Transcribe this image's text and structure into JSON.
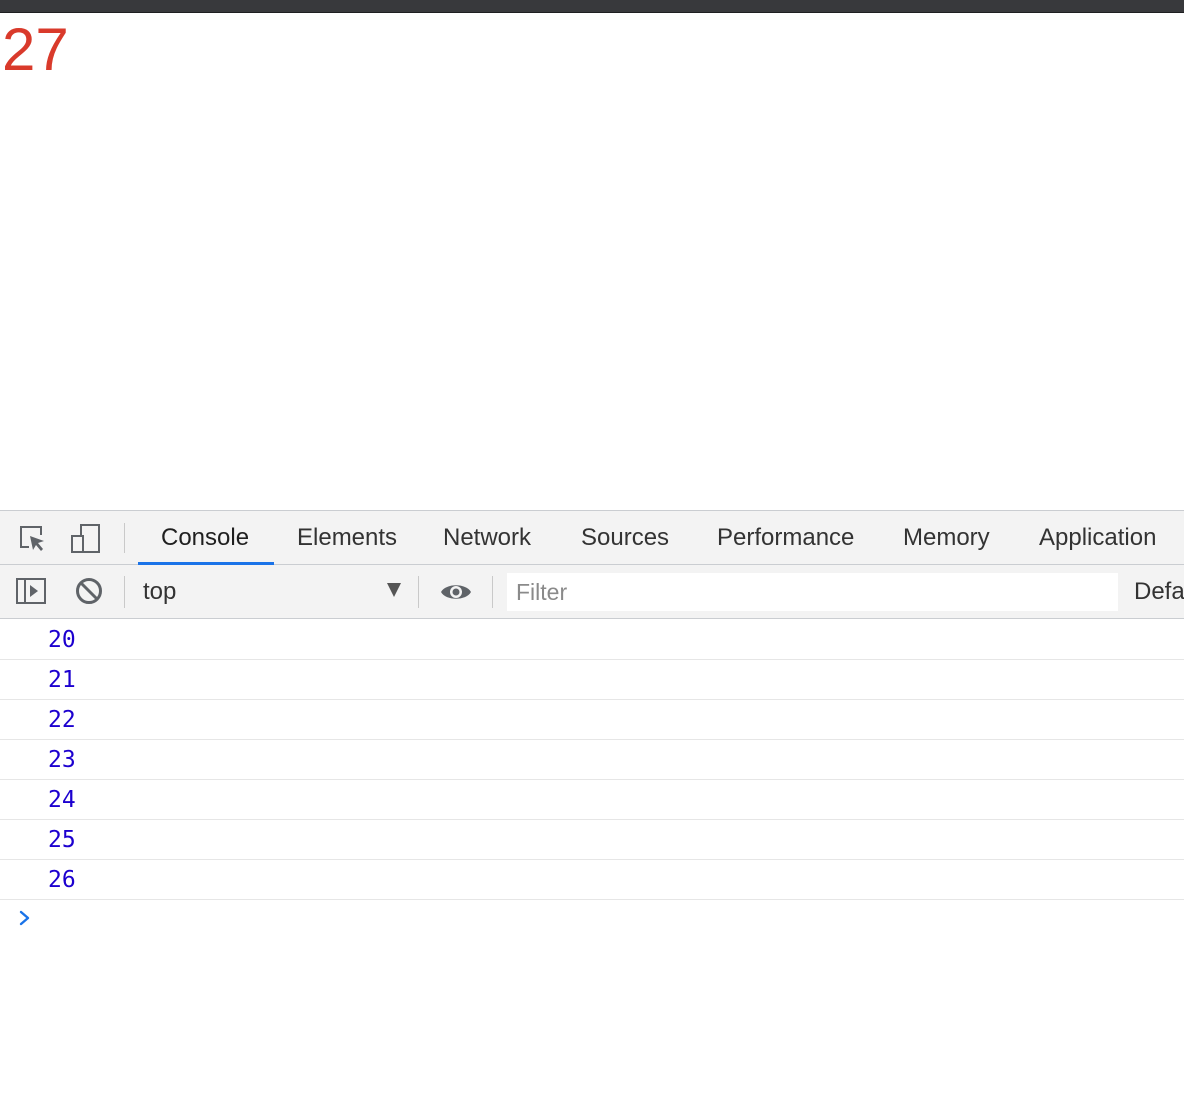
{
  "page": {
    "counter_value": "27"
  },
  "devtools": {
    "tabs": [
      {
        "label": "Console",
        "active": true
      },
      {
        "label": "Elements",
        "active": false
      },
      {
        "label": "Network",
        "active": false
      },
      {
        "label": "Sources",
        "active": false
      },
      {
        "label": "Performance",
        "active": false
      },
      {
        "label": "Memory",
        "active": false
      },
      {
        "label": "Application",
        "active": false
      }
    ],
    "toolbar_icons": [
      "inspect-element-icon",
      "device-toolbar-icon",
      "show-sidebar-icon",
      "clear-console-icon",
      "eye-icon"
    ],
    "context": {
      "selected": "top"
    },
    "filter": {
      "placeholder": "Filter",
      "value": ""
    },
    "levels_label": "Defa",
    "accent_color": "#1a73e8"
  },
  "console": {
    "rows": [
      "20",
      "21",
      "22",
      "23",
      "24",
      "25",
      "26"
    ],
    "value_color": "#1c00cf",
    "prompt_icon": "chevron-right-icon"
  },
  "colors": {
    "counter": "#d93a2b",
    "tabbar_bg": "#f3f3f3"
  }
}
